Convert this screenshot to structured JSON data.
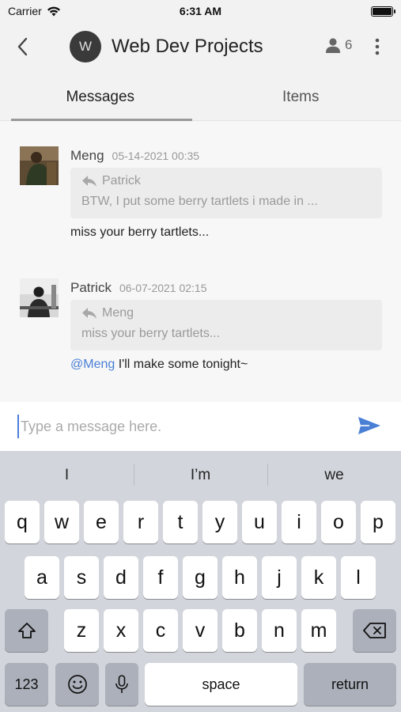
{
  "status_bar": {
    "carrier": "Carrier",
    "time": "6:31 AM",
    "battery_level": 1.0
  },
  "header": {
    "avatar_letter": "W",
    "title": "Web Dev Projects",
    "member_count": "6"
  },
  "tabs": [
    {
      "label": "Messages",
      "active": true
    },
    {
      "label": "Items",
      "active": false
    }
  ],
  "messages": [
    {
      "author": "Meng",
      "time": "05-14-2021 00:35",
      "quote": {
        "author": "Patrick",
        "text": "BTW, I put some berry tartlets i made in ..."
      },
      "body": "miss your berry tartlets..."
    },
    {
      "author": "Patrick",
      "time": "06-07-2021 02:15",
      "quote": {
        "author": "Meng",
        "text": "miss your berry tartlets..."
      },
      "mention": "@Meng",
      "body": " I'll make some tonight~"
    }
  ],
  "composer": {
    "placeholder": "Type a message here.",
    "value": ""
  },
  "keyboard": {
    "suggestions": [
      "I",
      "I’m",
      "we"
    ],
    "row1": [
      "q",
      "w",
      "e",
      "r",
      "t",
      "y",
      "u",
      "i",
      "o",
      "p"
    ],
    "row2": [
      "a",
      "s",
      "d",
      "f",
      "g",
      "h",
      "j",
      "k",
      "l"
    ],
    "row3": [
      "z",
      "x",
      "c",
      "v",
      "b",
      "n",
      "m"
    ],
    "numbers_label": "123",
    "space_label": "space",
    "return_label": "return"
  },
  "colors": {
    "accent": "#4a7fd6",
    "header_bg": "#f2f2f2",
    "keyboard_bg": "#d2d5db"
  },
  "icons": [
    "wifi-icon",
    "battery-icon",
    "back-icon",
    "members-icon",
    "more-icon",
    "reply-icon",
    "send-icon",
    "shift-icon",
    "delete-icon",
    "emoji-icon",
    "mic-icon"
  ]
}
